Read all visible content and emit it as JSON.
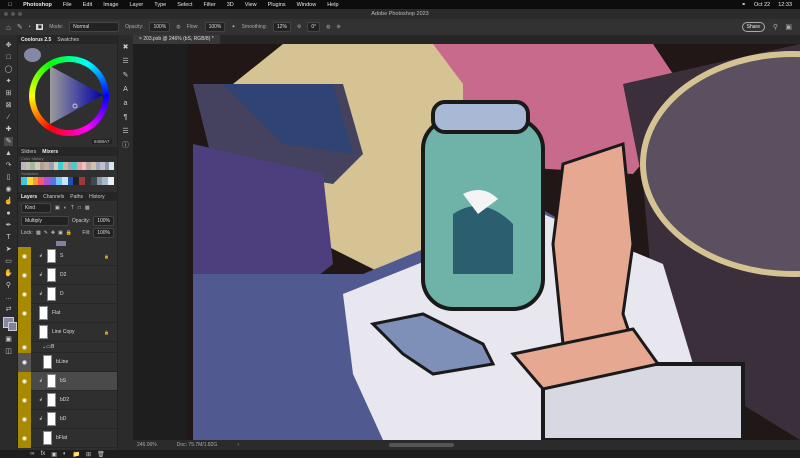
{
  "menubar": {
    "app": "Photoshop",
    "items": [
      "File",
      "Edit",
      "Image",
      "Layer",
      "Type",
      "Select",
      "Filter",
      "3D",
      "View",
      "Plugins",
      "Window",
      "Help"
    ],
    "date": "Oct 22",
    "time": "12:33"
  },
  "window_title": "Adobe Photoshop 2023",
  "options": {
    "mode_label": "Mode:",
    "mode": "Normal",
    "opacity_label": "Opacity:",
    "opacity": "100%",
    "flow_label": "Flow:",
    "flow": "100%",
    "smoothing_label": "Smoothing:",
    "smoothing": "12%",
    "angle": "0°",
    "share": "Share"
  },
  "color_panel": {
    "tabs": [
      "Coolorus 2.5",
      "Swatches"
    ],
    "hex": "8488A7",
    "current_color": "#8488a7",
    "mixer_tabs": [
      "Sliders",
      "Mixers"
    ],
    "color_history_label": "Color history",
    "swatches_label": "Swatches",
    "history_colors": [
      "#b8b4c8",
      "#c8c0a8",
      "#a0b8a0",
      "#d8c8b8",
      "#b0a0a0",
      "#c0b0a0",
      "#9aa0b8",
      "#d8d0c0",
      "#40d0d0",
      "#c8b8a8",
      "#a8a0b0",
      "#50c8c8",
      "#e8a0a0",
      "#f0c0c0",
      "#b8a8a0",
      "#d0c0b0",
      "#a0a8b8",
      "#c0c0d0",
      "#9098b0",
      "#d0e8f0"
    ],
    "swatch_colors": [
      "#3cc8d8",
      "#f8d838",
      "#f89838",
      "#f85868",
      "#b050d0",
      "#6070e0",
      "#70c8f8",
      "#c8e8f8",
      "#2050b0",
      "#202020",
      "#a03838",
      "#303030",
      "#404850",
      "#8898a8",
      "#a8b8c8",
      "#e8f0f8"
    ]
  },
  "layers_panel": {
    "tabs": [
      "Layers",
      "Channels",
      "Paths",
      "History"
    ],
    "filter": "Kind",
    "blend": "Multiply",
    "opacity_label": "Opacity:",
    "opacity": "100%",
    "lock_label": "Lock:",
    "fill_label": "Fill:",
    "fill": "100%",
    "layers": [
      {
        "name": "S",
        "visible": true,
        "clipped": true,
        "locked": true
      },
      {
        "name": "D2",
        "visible": true,
        "clipped": true
      },
      {
        "name": "D",
        "visible": true,
        "clipped": true
      },
      {
        "name": "Flat",
        "visible": true
      },
      {
        "name": "Line Copy",
        "visible": false,
        "locked": true
      },
      {
        "name": "B",
        "visible": true,
        "group": true
      },
      {
        "name": "bLine",
        "visible": true,
        "indent": true
      },
      {
        "name": "bS",
        "visible": true,
        "clipped": true,
        "selected": true
      },
      {
        "name": "bD2",
        "visible": true,
        "clipped": true
      },
      {
        "name": "bD",
        "visible": true,
        "clipped": true
      },
      {
        "name": "bFlat",
        "visible": true,
        "indent": true
      }
    ]
  },
  "document": {
    "tab": "203.psb @ 246% (bS, RGB/8) *",
    "zoom": "246.06%",
    "doc_size": "Doc: 75.7M/1.82G"
  }
}
